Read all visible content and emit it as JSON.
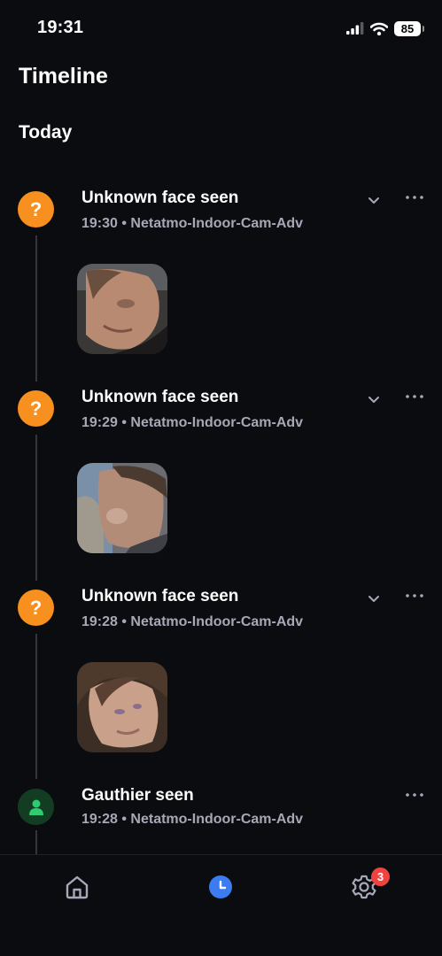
{
  "status_bar": {
    "time": "19:31",
    "battery": "85",
    "icons": [
      "cellular-signal-icon",
      "wifi-icon",
      "battery-icon"
    ]
  },
  "header": {
    "title": "Timeline"
  },
  "section": {
    "title": "Today"
  },
  "events": [
    {
      "badge_icon": "question-icon",
      "badge_glyph": "?",
      "title": "Unknown face seen",
      "meta": "19:30 • Netatmo-Indoor-Cam-Adv",
      "has_expand": true,
      "has_thumbnail": true
    },
    {
      "badge_icon": "question-icon",
      "badge_glyph": "?",
      "title": "Unknown face seen",
      "meta": "19:29 • Netatmo-Indoor-Cam-Adv",
      "has_expand": true,
      "has_thumbnail": true
    },
    {
      "badge_icon": "question-icon",
      "badge_glyph": "?",
      "title": "Unknown face seen",
      "meta": "19:28 • Netatmo-Indoor-Cam-Adv",
      "has_expand": true,
      "has_thumbnail": true
    },
    {
      "badge_icon": "person-icon",
      "title": "Gauthier seen",
      "meta": "19:28 • Netatmo-Indoor-Cam-Adv",
      "has_expand": false,
      "has_thumbnail": false
    }
  ],
  "tab_bar": {
    "tabs": [
      {
        "icon": "home-icon",
        "active": false
      },
      {
        "icon": "clock-icon",
        "active": true
      },
      {
        "icon": "gear-icon",
        "active": false
      }
    ],
    "settings_badge": "3"
  },
  "colors": {
    "background": "#0b0c0f",
    "unknown_badge": "#f7901e",
    "known_badge": "#123d22",
    "known_icon": "#2ecc71",
    "active_tab": "#3b7cf0",
    "notification_badge": "#f0433f",
    "meta_text": "#a6a8b8"
  }
}
